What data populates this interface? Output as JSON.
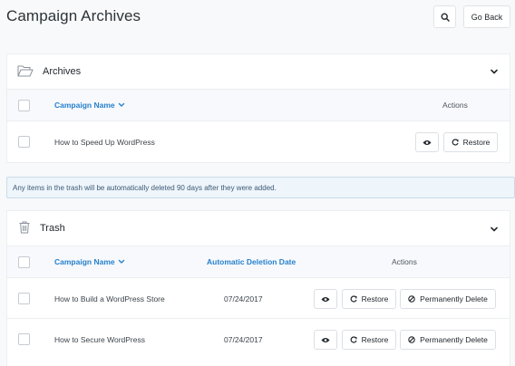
{
  "header": {
    "title": "Campaign Archives",
    "search_icon": "search-icon",
    "go_back_label": "Go Back"
  },
  "archives": {
    "title": "Archives",
    "icon": "folder-open-icon",
    "columns": {
      "name": "Campaign Name",
      "actions": "Actions"
    },
    "rows": [
      {
        "name": "How to Speed Up WordPress",
        "restore_label": "Restore"
      }
    ]
  },
  "notice": {
    "text": "Any items in the trash will be automatically deleted 90 days after they were added."
  },
  "trash": {
    "title": "Trash",
    "icon": "trash-icon",
    "columns": {
      "name": "Campaign Name",
      "date": "Automatic Deletion Date",
      "actions": "Actions"
    },
    "rows": [
      {
        "name": "How to Build a WordPress Store",
        "date": "07/24/2017",
        "restore_label": "Restore",
        "delete_label": "Permanently Delete"
      },
      {
        "name": "How to Secure WordPress",
        "date": "07/24/2017",
        "restore_label": "Restore",
        "delete_label": "Permanently Delete"
      }
    ]
  },
  "colors": {
    "accent": "#2680cc",
    "notice_bg": "#eef5fb",
    "notice_text": "#3d5a75"
  }
}
